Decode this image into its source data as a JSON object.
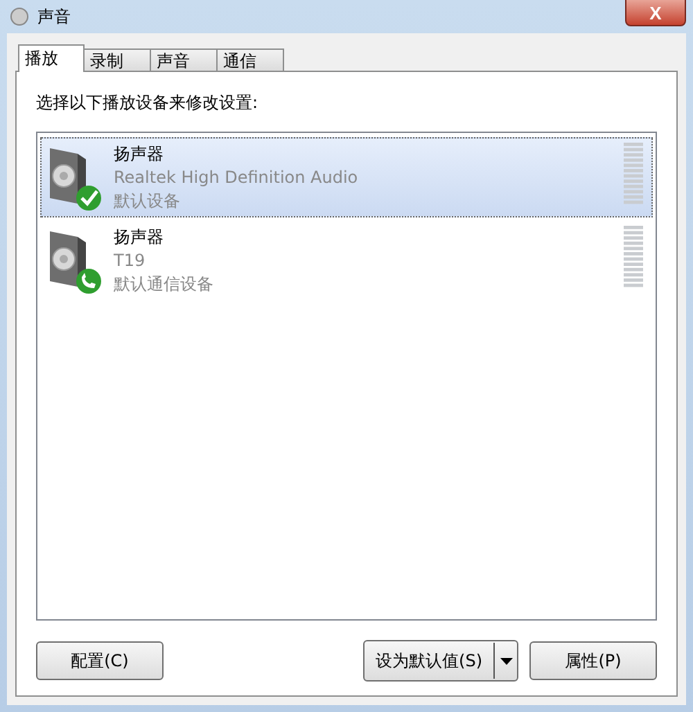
{
  "window": {
    "title": "声音",
    "close": "X"
  },
  "tabs": [
    {
      "label": "播放",
      "selected": true
    },
    {
      "label": "录制",
      "selected": false
    },
    {
      "label": "声音",
      "selected": false
    },
    {
      "label": "通信",
      "selected": false
    }
  ],
  "instruction": "选择以下播放设备来修改设置:",
  "devices": [
    {
      "name": "扬声器",
      "description": "Realtek High Definition Audio",
      "status": "默认设备",
      "kind": "default",
      "selected": true
    },
    {
      "name": "扬声器",
      "description": "T19",
      "status": "默认通信设备",
      "kind": "communications",
      "selected": false
    }
  ],
  "buttons": {
    "configure": "配置(C)",
    "set_default": "设为默认值(S)",
    "properties": "属性(P)"
  }
}
